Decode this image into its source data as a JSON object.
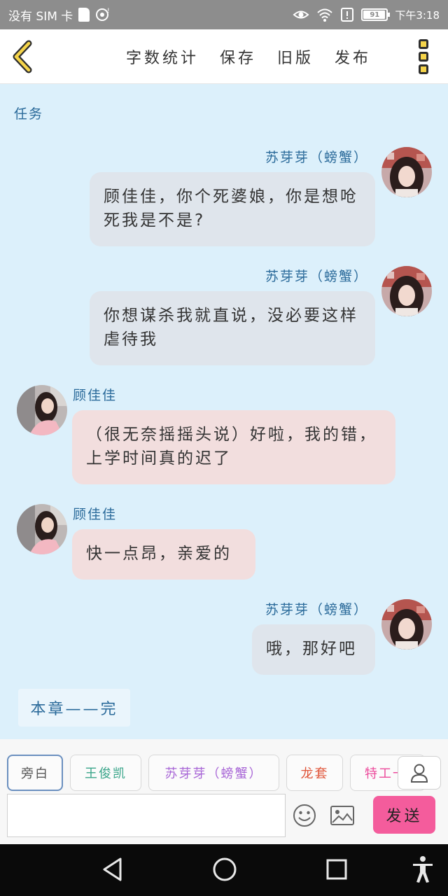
{
  "status_bar": {
    "carrier": "没有 SIM 卡",
    "battery": "91",
    "time": "下午3:18"
  },
  "toolbar": {
    "actions": [
      "字数统计",
      "保存",
      "旧版",
      "发布"
    ]
  },
  "chat": {
    "section_label": "任务",
    "messages": [
      {
        "side": "right",
        "speaker": "苏芽芽（螃蟹）",
        "text": "顾佳佳，你个死婆娘，你是想呛死我是不是?"
      },
      {
        "side": "right",
        "speaker": "苏芽芽（螃蟹）",
        "text": "你想谋杀我就直说，没必要这样虐待我"
      },
      {
        "side": "left",
        "speaker": "顾佳佳",
        "text": "（很无奈摇摇头说）好啦，我的错，上学时间真的迟了"
      },
      {
        "side": "left",
        "speaker": "顾佳佳",
        "text": "快一点昂，亲爱的"
      },
      {
        "side": "right",
        "speaker": "苏芽芽（螃蟹）",
        "text": "哦，那好吧"
      }
    ],
    "chapter_end": "本章——完"
  },
  "panel": {
    "roles": [
      {
        "label": "旁白",
        "color": "#555555"
      },
      {
        "label": "王俊凯",
        "color": "#3aa58a"
      },
      {
        "label": "苏芽芽（螃蟹）",
        "color": "#a764d6"
      },
      {
        "label": "龙套",
        "color": "#e0553a"
      },
      {
        "label": "特工一",
        "color": "#ec4b9c"
      }
    ],
    "input_placeholder": "",
    "send_label": "发送"
  },
  "colors": {
    "chat_bg": "#dcf0fb",
    "bubble_right": "#dfe5ec",
    "bubble_left": "#f2dede",
    "accent_name": "#2a6a9a",
    "send": "#f45c9c"
  },
  "icons": [
    "back-chevron-icon",
    "more-icon",
    "profile-icon",
    "emoji-icon",
    "image-icon",
    "nav-back-icon",
    "nav-home-icon",
    "nav-recents-icon",
    "accessibility-icon"
  ]
}
